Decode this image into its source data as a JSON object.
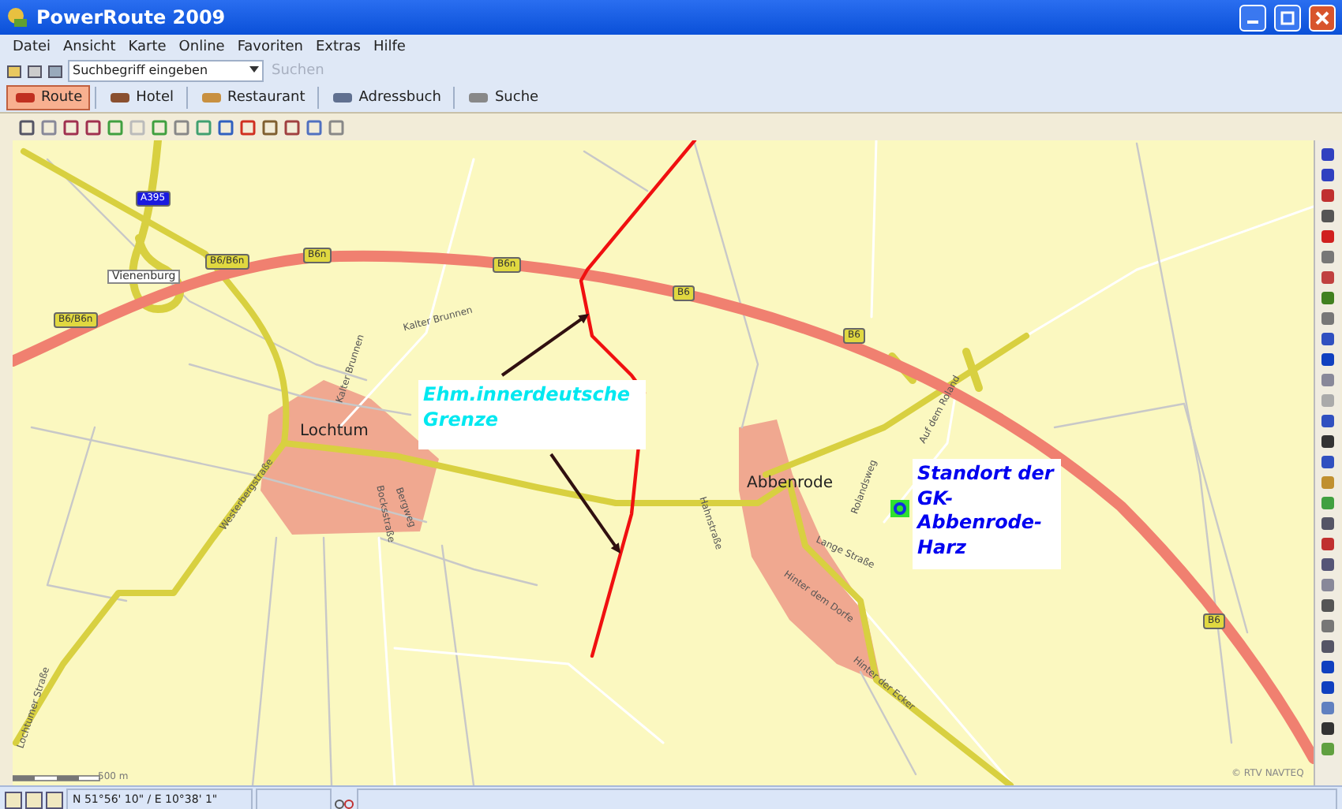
{
  "window": {
    "title": "PowerRoute 2009"
  },
  "menu": [
    "Datei",
    "Ansicht",
    "Karte",
    "Online",
    "Favoriten",
    "Extras",
    "Hilfe"
  ],
  "search_bar": {
    "placeholder": "Suchbegriff eingeben",
    "button": {
      "label": "Suchen",
      "disabled": true
    }
  },
  "categories": [
    {
      "label": "Route",
      "selected": true
    },
    {
      "label": "Hotel",
      "selected": false
    },
    {
      "label": "Restaurant",
      "selected": false
    },
    {
      "label": "Adressbuch",
      "selected": false
    },
    {
      "label": "Suche",
      "selected": false
    }
  ],
  "map": {
    "labels": [
      {
        "kind": "shield",
        "text": "A395",
        "color": "#1a1ae0"
      },
      {
        "kind": "place",
        "text": "Vienenburg"
      },
      {
        "kind": "shield",
        "text": "B6/B6n",
        "color": "#e0d840"
      },
      {
        "kind": "shield",
        "text": "B6n",
        "color": "#e0d840"
      },
      {
        "kind": "shield",
        "text": "B6n",
        "color": "#e0d840"
      },
      {
        "kind": "shield",
        "text": "B6/B6n",
        "color": "#e0d840"
      },
      {
        "kind": "shield",
        "text": "B6",
        "color": "#e0d840"
      },
      {
        "kind": "shield",
        "text": "B6",
        "color": "#e0d840"
      },
      {
        "kind": "shield",
        "text": "B6",
        "color": "#e0d840"
      },
      {
        "kind": "street",
        "text": "Kalter Brunnen"
      },
      {
        "kind": "street",
        "text": "Kalter Brunnen"
      },
      {
        "kind": "town",
        "text": "Lochtum"
      },
      {
        "kind": "street",
        "text": "Westerbergstraße"
      },
      {
        "kind": "street",
        "text": "Bocksstraße"
      },
      {
        "kind": "street",
        "text": "Bergweg"
      },
      {
        "kind": "town",
        "text": "Abbenrode"
      },
      {
        "kind": "street",
        "text": "Auf dem Roland"
      },
      {
        "kind": "street",
        "text": "Rolandsweg"
      },
      {
        "kind": "street",
        "text": "Hahnstraße"
      },
      {
        "kind": "street",
        "text": "Lange Straße"
      },
      {
        "kind": "street",
        "text": "Hinter dem Dorfe"
      },
      {
        "kind": "street",
        "text": "Hinter der Ecker"
      },
      {
        "kind": "street",
        "text": "Lochtumer Straße"
      },
      {
        "kind": "note",
        "text": "Ehm.innerdeutsche Grenze",
        "color": "#00e8f0"
      },
      {
        "kind": "note",
        "text": "Standort der GK-Abbenrode-Harz",
        "color": "#0000f0"
      },
      {
        "kind": "scale",
        "text": "500 m"
      },
      {
        "kind": "copyright",
        "text": "© RTV NAVTEQ"
      }
    ]
  },
  "status_bar": {
    "coordinates": "N 51°56' 10\" / E 10°38' 1\""
  }
}
